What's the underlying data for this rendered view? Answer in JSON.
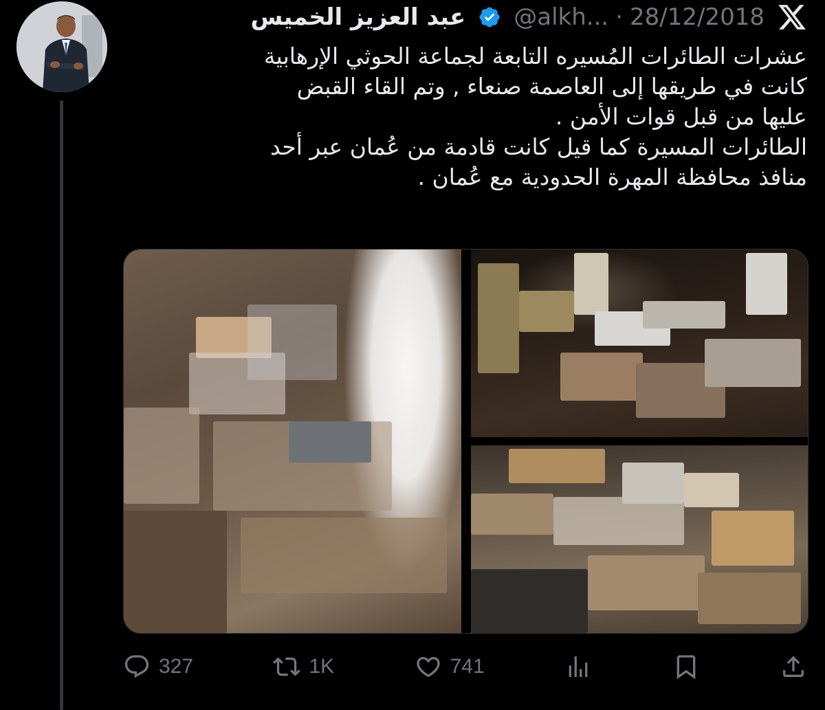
{
  "tweet": {
    "author_name": "عبد العزيز الخميس",
    "handle": "@alkh...",
    "separator": "·",
    "date": "28/12/2018",
    "text_lines": [
      "عشرات الطائرات المُسيره التابعة لجماعة الحوثي الإرهابية",
      "كانت في طريقها إلى العاصمة صنعاء , وتم القاء القبض",
      "عليها من قبل قوات الأمن .",
      "الطائرات المسيرة كما قيل كانت قادمة من عُمان عبر أحد",
      "منافذ محافظة المهرة الحدودية مع عُمان ."
    ]
  },
  "actions": {
    "replies": "327",
    "reposts": "1K",
    "likes": "741"
  },
  "icons": {
    "logo": "x-logo-icon",
    "verified": "verified-badge-icon",
    "reply": "reply-icon",
    "repost": "repost-icon",
    "like": "heart-icon",
    "views": "analytics-icon",
    "bookmark": "bookmark-icon",
    "share": "share-icon"
  },
  "colors": {
    "background": "#000000",
    "text": "#e7e9ea",
    "muted": "#71767b",
    "verified": "#1d9bf0"
  }
}
